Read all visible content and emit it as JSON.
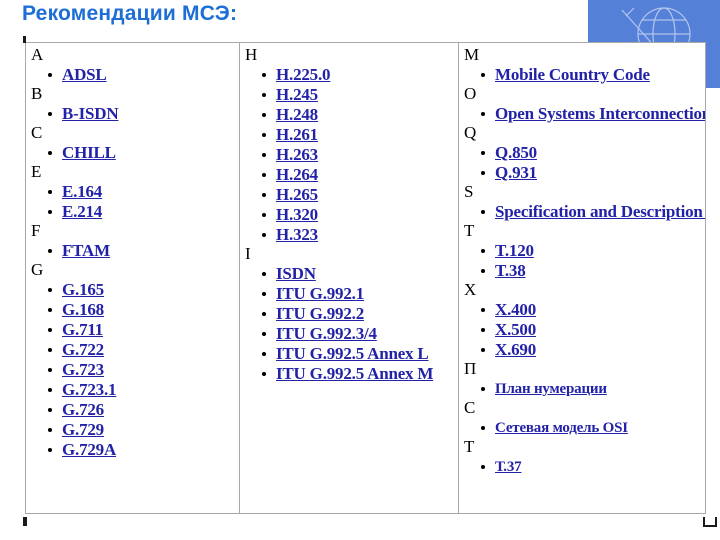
{
  "slide": {
    "title": "Рекомендации МСЭ:",
    "title_color": "#1d6fd6",
    "link_color": "#2222a8",
    "accent_block_color": "#5580d8",
    "table_border_color": "#a8a8a8"
  },
  "corner": {
    "logo_icon": "itu-globe-antenna-icon"
  },
  "table": {
    "columns": [
      {
        "name": "column-1",
        "groups": [
          {
            "letter": "A",
            "items": [
              "ADSL"
            ]
          },
          {
            "letter": "B",
            "items": [
              "B-ISDN"
            ]
          },
          {
            "letter": "C",
            "items": [
              "CHILL"
            ]
          },
          {
            "letter": "E",
            "items": [
              "E.164",
              "E.214"
            ]
          },
          {
            "letter": "F",
            "items": [
              "FTAM"
            ]
          },
          {
            "letter": "G",
            "items": [
              "G.165",
              "G.168",
              "G.711",
              "G.722",
              "G.723",
              "G.723.1",
              "G.726",
              "G.729",
              "G.729A"
            ]
          }
        ]
      },
      {
        "name": "column-2",
        "groups": [
          {
            "letter": "H",
            "items": [
              "H.225.0",
              "H.245",
              "H.248",
              "H.261",
              "H.263",
              "H.264",
              "H.265",
              "H.320",
              "H.323"
            ]
          },
          {
            "letter": "I",
            "items": [
              "ISDN",
              "ITU G.992.1",
              "ITU G.992.2",
              "ITU G.992.3/4",
              "ITU G.992.5 Annex L",
              "ITU G.992.5 Annex M"
            ]
          }
        ]
      },
      {
        "name": "column-3",
        "groups": [
          {
            "letter": "M",
            "items": [
              "Mobile Country Code"
            ]
          },
          {
            "letter": "O",
            "items": [
              "Open Systems Interconnection"
            ]
          },
          {
            "letter": "Q",
            "items": [
              "Q.850",
              "Q.931"
            ]
          },
          {
            "letter": "S",
            "items": [
              "Specification and Description Language"
            ]
          },
          {
            "letter": "T",
            "items": [
              "T.120",
              "T.38"
            ]
          },
          {
            "letter": "X",
            "items": [
              "X.400",
              "X.500",
              "X.690"
            ]
          },
          {
            "letter": "П",
            "items": [
              "План нумерации"
            ]
          },
          {
            "letter": "С",
            "items": [
              "Сетевая модель OSI"
            ]
          },
          {
            "letter": "Т",
            "items": [
              "Т.37"
            ]
          }
        ]
      }
    ]
  }
}
